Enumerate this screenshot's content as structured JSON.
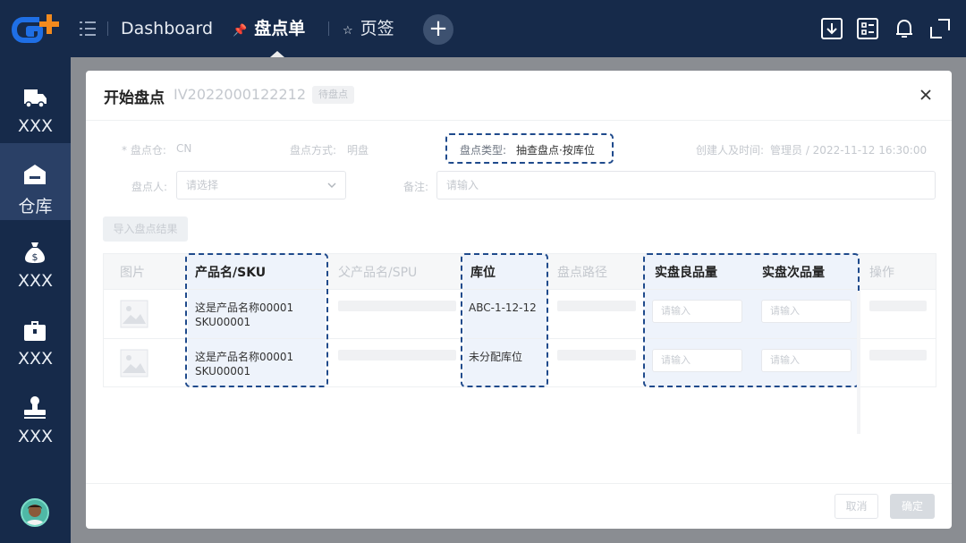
{
  "topbar": {
    "tabs": [
      {
        "label": "Dashboard"
      },
      {
        "label": "盘点单",
        "active": true
      },
      {
        "label": "页签"
      }
    ],
    "add_label": "+"
  },
  "sidebar": {
    "items": [
      {
        "label": "XXX",
        "icon": "truck-icon"
      },
      {
        "label": "仓库",
        "icon": "warehouse-icon",
        "active": true
      },
      {
        "label": "XXX",
        "icon": "money-bag-icon"
      },
      {
        "label": "XXX",
        "icon": "toolbox-icon"
      },
      {
        "label": "XXX",
        "icon": "stamp-icon"
      }
    ]
  },
  "modal": {
    "title": "开始盘点",
    "code": "IV2022000122212",
    "status": "待盘点",
    "fields": {
      "warehouse_label": "* 盘点仓:",
      "warehouse_value": "CN",
      "method_label": "盘点方式:",
      "method_value": "明盘",
      "type_label": "盘点类型:",
      "type_value": "抽查盘点·按库位",
      "creator_label": "创建人及时间:",
      "creator_value": "管理员 / 2022-11-12 16:30:00",
      "counter_label": "盘点人:",
      "counter_placeholder": "请选择",
      "remark_label": "备注:",
      "remark_placeholder": "请输入"
    },
    "import_label": "导入盘点结果",
    "table": {
      "headers": [
        "图片",
        "产品名/SKU",
        "父产品名/SPU",
        "库位",
        "盘点路径",
        "实盘良品量",
        "实盘次品量",
        "操作"
      ],
      "rows": [
        {
          "name": "这是产品名称00001",
          "sku": "SKU00001",
          "location": "ABC-1-12-12",
          "good_placeholder": "请输入",
          "bad_placeholder": "请输入"
        },
        {
          "name": "这是产品名称00001",
          "sku": "SKU00001",
          "location": "未分配库位",
          "good_placeholder": "请输入",
          "bad_placeholder": "请输入"
        }
      ]
    },
    "cancel_label": "取消",
    "confirm_label": "确定"
  },
  "colors": {
    "nav_bg": "#162a4a",
    "accent_blue": "#1f6fe5",
    "accent_orange": "#f28a1e",
    "highlight_dash": "#1f4a8c"
  }
}
